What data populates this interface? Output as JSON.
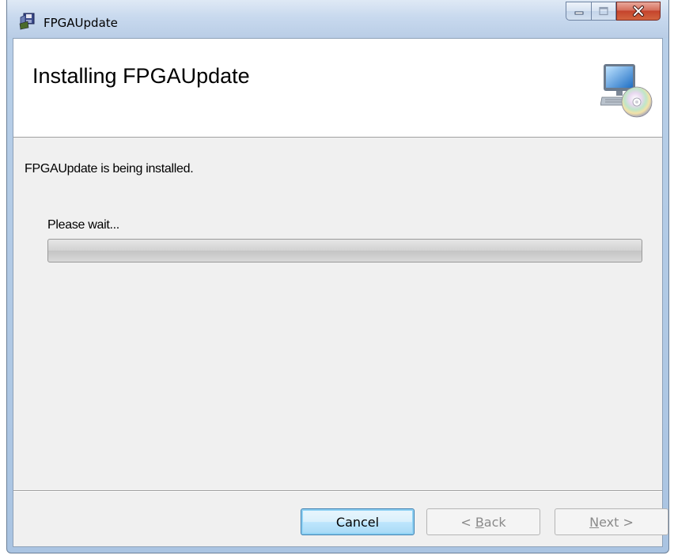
{
  "window": {
    "title": "FPGAUpdate"
  },
  "banner": {
    "title": "Installing FPGAUpdate"
  },
  "content": {
    "status": "FPGAUpdate is being installed.",
    "wait_label": "Please wait...",
    "progress_percent": 0
  },
  "buttons": {
    "cancel": "Cancel",
    "back_accel": "B",
    "back_rest": "ack",
    "back_prefix": "< ",
    "next_accel": "N",
    "next_rest": "ext",
    "next_suffix": " >"
  },
  "colors": {
    "accent_cancel_border": "#3c7fb1",
    "close_button": "#c4432c",
    "banner_bg": "#ffffff",
    "client_bg": "#f0f0f0"
  },
  "icons": {
    "title": "installer-package-icon",
    "banner": "computer-disc-icon",
    "minimize": "minimize-icon",
    "maximize": "maximize-icon",
    "close": "close-icon"
  }
}
